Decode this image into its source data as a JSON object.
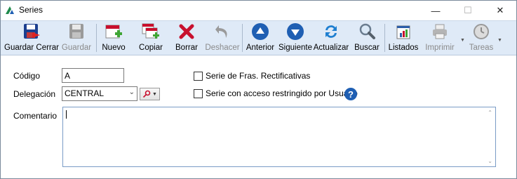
{
  "window": {
    "title": "Series",
    "controls": {
      "minimize": "—",
      "maximize": "☐",
      "close": "✕"
    }
  },
  "toolbar": {
    "buttons": [
      {
        "id": "guardar-cerrar",
        "label": "Guardar Cerrar",
        "icon": "save-close-icon",
        "enabled": true
      },
      {
        "id": "guardar",
        "label": "Guardar",
        "icon": "save-icon",
        "enabled": false
      },
      {
        "id": "nuevo",
        "label": "Nuevo",
        "icon": "new-icon",
        "enabled": true
      },
      {
        "id": "copiar",
        "label": "Copiar",
        "icon": "copy-icon",
        "enabled": true
      },
      {
        "id": "borrar",
        "label": "Borrar",
        "icon": "delete-icon",
        "enabled": true
      },
      {
        "id": "deshacer",
        "label": "Deshacer",
        "icon": "undo-icon",
        "enabled": false
      },
      {
        "id": "anterior",
        "label": "Anterior",
        "icon": "arrow-up-icon",
        "enabled": true
      },
      {
        "id": "siguiente",
        "label": "Siguiente",
        "icon": "arrow-down-icon",
        "enabled": true
      },
      {
        "id": "actualizar",
        "label": "Actualizar",
        "icon": "refresh-icon",
        "enabled": true
      },
      {
        "id": "buscar",
        "label": "Buscar",
        "icon": "search-icon",
        "enabled": true
      },
      {
        "id": "listados",
        "label": "Listados",
        "icon": "reports-icon",
        "enabled": true
      },
      {
        "id": "imprimir",
        "label": "Imprimir",
        "icon": "printer-icon",
        "enabled": false
      },
      {
        "id": "tareas",
        "label": "Tareas",
        "icon": "clock-icon",
        "enabled": false
      }
    ]
  },
  "form": {
    "codigo": {
      "label": "Código",
      "value": "A"
    },
    "delegacion": {
      "label": "Delegación",
      "value": "CENTRAL"
    },
    "comentario": {
      "label": "Comentario",
      "value": ""
    },
    "rectificativas": {
      "label": "Serie de Fras. Rectificativas",
      "checked": false
    },
    "acceso_restringido": {
      "label": "Serie con acceso restringido por Usuario",
      "checked": false
    }
  },
  "colors": {
    "toolbar_bg": "#dfeaf7",
    "accent_blue": "#1f5fb3",
    "delete_red": "#c8102e",
    "new_green": "#3fa535"
  }
}
